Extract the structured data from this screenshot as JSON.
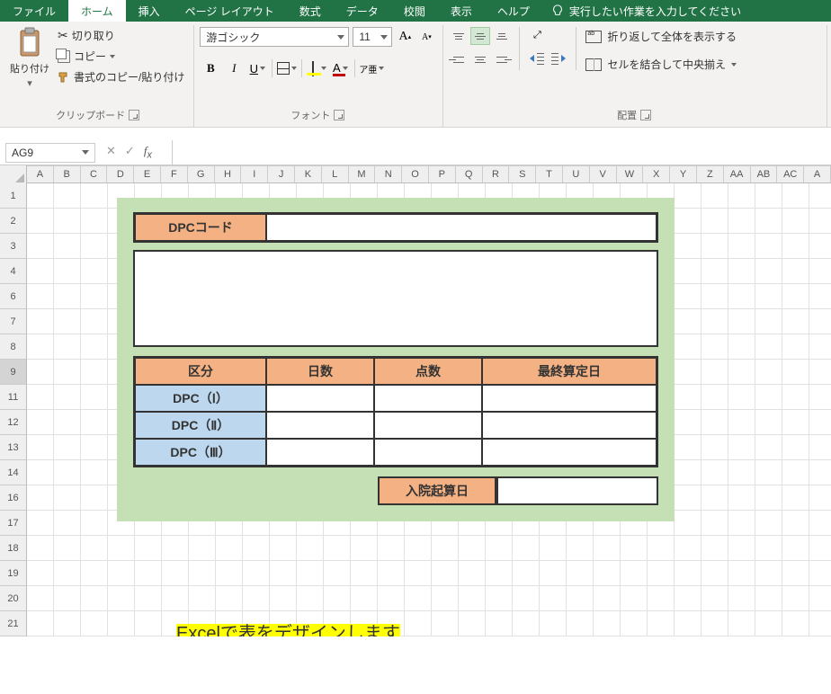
{
  "tabs": {
    "file": "ファイル",
    "home": "ホーム",
    "insert": "挿入",
    "pagelayout": "ページ レイアウト",
    "formulas": "数式",
    "data": "データ",
    "review": "校閲",
    "view": "表示",
    "help": "ヘルプ",
    "tellme": "実行したい作業を入力してください"
  },
  "clipboard": {
    "paste": "貼り付け",
    "cut": "切り取り",
    "copy": "コピー",
    "formatpainter": "書式のコピー/貼り付け",
    "group": "クリップボード"
  },
  "font": {
    "name": "游ゴシック",
    "size": "11",
    "group": "フォント",
    "bold": "B",
    "italic": "I",
    "underline": "U",
    "fontcolor_letter": "A",
    "ruby": "ア亜"
  },
  "align": {
    "group": "配置",
    "wrap": "折り返して全体を表示する",
    "merge": "セルを結合して中央揃え"
  },
  "namebox": "AG9",
  "columns": [
    "A",
    "B",
    "C",
    "D",
    "E",
    "F",
    "G",
    "H",
    "I",
    "J",
    "K",
    "L",
    "M",
    "N",
    "O",
    "P",
    "Q",
    "R",
    "S",
    "T",
    "U",
    "V",
    "W",
    "X",
    "Y",
    "Z",
    "AA",
    "AB",
    "AC",
    "A"
  ],
  "rows": [
    "1",
    "2",
    "3",
    "4",
    "6",
    "7",
    "8",
    "9",
    "11",
    "12",
    "13",
    "14",
    "16",
    "17",
    "18",
    "19",
    "20",
    "21"
  ],
  "row_heights": {
    "default": 28
  },
  "active_row_index": 7,
  "form": {
    "dpc_code": "DPCコード",
    "kubun": "区分",
    "nissu": "日数",
    "tensu": "点数",
    "saishu": "最終算定日",
    "dpc1": "DPC（Ⅰ）",
    "dpc2": "DPC（Ⅱ）",
    "dpc3": "DPC（Ⅲ）",
    "nyuin": "入院起算日"
  },
  "highlight": "Excelで表をデザインします"
}
